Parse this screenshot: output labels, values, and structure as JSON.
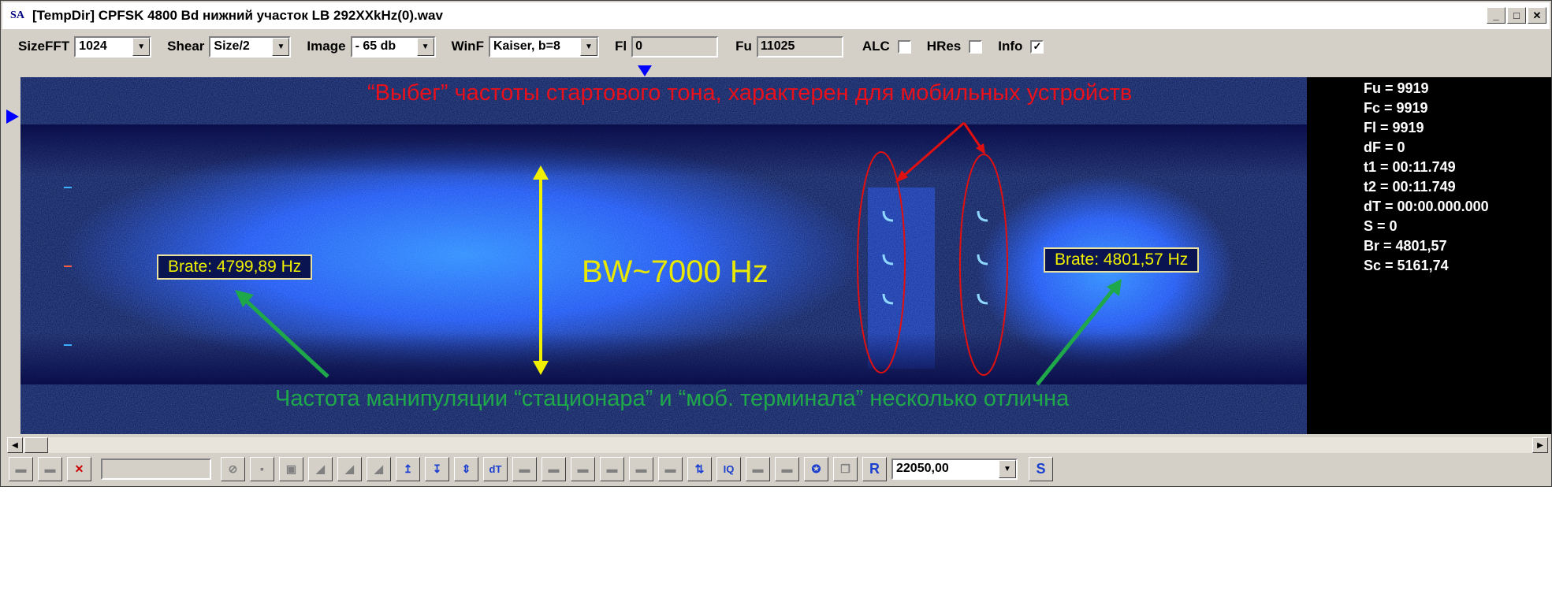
{
  "window": {
    "app_icon": "SA",
    "title": "[TempDir] CPFSK 4800 Bd нижний участок LB 292XXkHz(0).wav",
    "controls": [
      "minimize-icon",
      "maximize-icon",
      "close-icon"
    ]
  },
  "toolbar": {
    "sizefft_label": "SizeFFT",
    "sizefft_value": "1024",
    "shear_label": "Shear",
    "shear_value": "Size/2",
    "image_label": "Image",
    "image_value": "- 65 db",
    "winf_label": "WinF",
    "winf_value": "Kaiser, b=8",
    "fl_label": "Fl",
    "fl_value": "0",
    "fu_label": "Fu",
    "fu_value": "11025",
    "alc_label": "ALC",
    "alc_checked": false,
    "hres_label": "HRes",
    "hres_checked": false,
    "info_label": "Info",
    "info_checked": true,
    "check_mark": "✓"
  },
  "info_panel": {
    "lines": [
      "Fu = 9919",
      "Fc = 9919",
      "Fl = 9919",
      "dF = 0",
      "t1 = 00:11.749",
      "t2 = 00:11.749",
      "dT = 00:00.000.000",
      "S = 0",
      "Br = 4801,57",
      "Sc = 5161,74"
    ]
  },
  "annotations": {
    "top_note": "“Выбег” частоты стартового тона, характерен для мобильных устройств",
    "bandwidth": "BW~7000 Hz",
    "brate_left": "Brate:  4799,89 Hz",
    "brate_right": "Brate:  4801,57 Hz",
    "bottom_note": "Частота манипуляции “стационара” и “моб. терминала” несколько отлична",
    "colors": {
      "top_note": "#e8101a",
      "bandwidth": "#e8e800",
      "bottom_note": "#1fa84a",
      "ellipse": "#e01010",
      "arrow_green": "#1fa84a",
      "arrow_yellow": "#f0f000"
    }
  },
  "bottom_toolbar": {
    "frequency_value": "22050,00",
    "dt_label": "dT",
    "iq_label": "IQ",
    "r_label": "R",
    "s_label": "S"
  }
}
